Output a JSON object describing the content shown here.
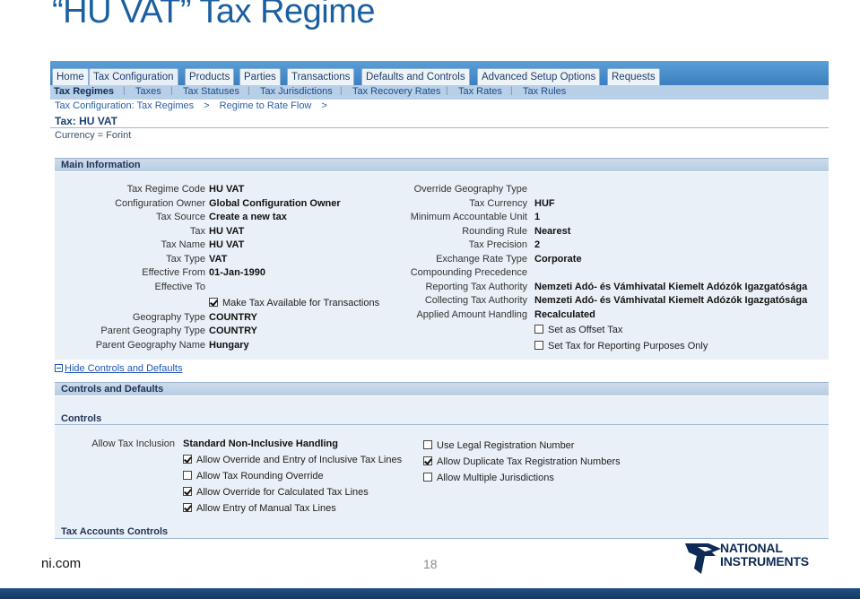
{
  "slide": {
    "title": "“HU VAT” Tax Regime",
    "footer_left": "ni.com",
    "page_number": "18",
    "logo_lines": [
      "NATIONAL",
      "INSTRUMENTS"
    ]
  },
  "tabs": [
    "Home",
    "Tax Configuration",
    "Products",
    "Parties",
    "Transactions",
    "Defaults and Controls",
    "Advanced Setup Options",
    "Requests"
  ],
  "active_tab": "Tax Configuration",
  "subtabs": [
    "Tax Regimes",
    "Taxes",
    "Tax Statuses",
    "Tax Jurisdictions",
    "Tax Recovery Rates",
    "Tax Rates",
    "Tax Rules"
  ],
  "active_subtab": "Tax Regimes",
  "breadcrumb": [
    "Tax Configuration: Tax Regimes",
    ">",
    "Regime to Rate Flow",
    ">"
  ],
  "page_heading": "Tax: HU VAT",
  "currency": "Currency = Forint",
  "main": {
    "title": "Main Information",
    "left": [
      {
        "label": "Tax Regime Code",
        "value": "HU VAT"
      },
      {
        "label": "Configuration Owner",
        "value": "Global Configuration Owner"
      },
      {
        "label": "Tax Source",
        "value": "Create a new tax"
      },
      {
        "label": "Tax",
        "value": "HU VAT"
      },
      {
        "label": "Tax Name",
        "value": "HU VAT"
      },
      {
        "label": "Tax Type",
        "value": "VAT"
      },
      {
        "label": "Effective From",
        "value": "01-Jan-1990"
      },
      {
        "label": "Effective To",
        "value": ""
      }
    ],
    "make_available_label": "Make Tax Available for Transactions",
    "make_available_checked": true,
    "left_lower": [
      {
        "label": "Geography Type",
        "value": "COUNTRY"
      },
      {
        "label": "Parent Geography Type",
        "value": "COUNTRY"
      },
      {
        "label": "Parent Geography Name",
        "value": "Hungary"
      }
    ],
    "right": [
      {
        "label": "Override Geography Type",
        "value": ""
      },
      {
        "label": "Tax Currency",
        "value": "HUF"
      },
      {
        "label": "Minimum Accountable Unit",
        "value": "1"
      },
      {
        "label": "Rounding Rule",
        "value": "Nearest"
      },
      {
        "label": "Tax Precision",
        "value": "2"
      },
      {
        "label": "Exchange Rate Type",
        "value": "Corporate"
      },
      {
        "label": "Compounding Precedence",
        "value": ""
      },
      {
        "label": "Reporting Tax Authority",
        "value": "Nemzeti Adó- és Vámhivatal Kiemelt Adózók Igazgatósága"
      },
      {
        "label": "Collecting Tax Authority",
        "value": "Nemzeti Adó- és Vámhivatal Kiemelt Adózók Igazgatósága"
      },
      {
        "label": "Applied Amount Handling",
        "value": "Recalculated"
      }
    ],
    "right_checks": [
      {
        "label": "Set as Offset Tax",
        "checked": false
      },
      {
        "label": "Set Tax for Reporting Purposes Only",
        "checked": false
      }
    ]
  },
  "hide_link": "Hide Controls and Defaults",
  "controls": {
    "section_title": "Controls and Defaults",
    "subheading": "Controls",
    "inclusion_label": "Allow Tax Inclusion",
    "inclusion_value": "Standard Non-Inclusive Handling",
    "left_checks": [
      {
        "label": "Allow Override and Entry of Inclusive Tax Lines",
        "checked": true
      },
      {
        "label": "Allow Tax Rounding Override",
        "checked": false
      },
      {
        "label": "Allow Override for Calculated Tax Lines",
        "checked": true
      },
      {
        "label": "Allow Entry of Manual Tax Lines",
        "checked": true
      }
    ],
    "right_checks": [
      {
        "label": "Use Legal Registration Number",
        "checked": false
      },
      {
        "label": "Allow Duplicate Tax Registration Numbers",
        "checked": true
      },
      {
        "label": "Allow Multiple Jurisdictions",
        "checked": false
      }
    ],
    "accounts_heading": "Tax Accounts Controls"
  }
}
